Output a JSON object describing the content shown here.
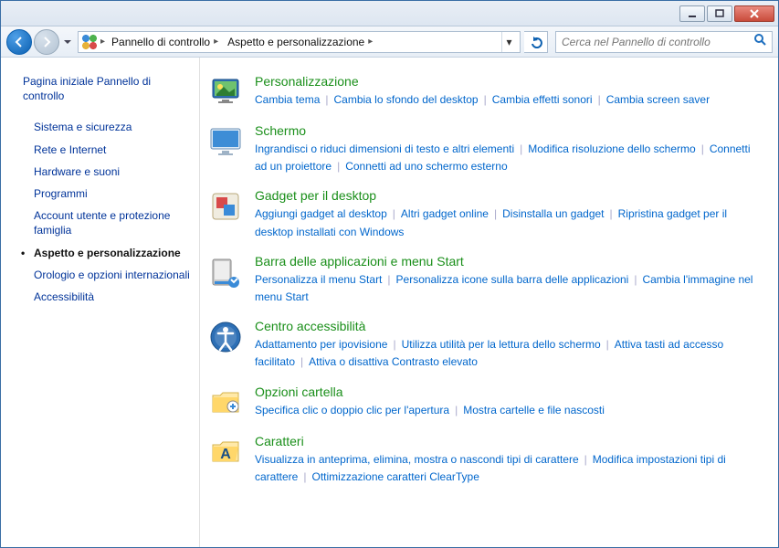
{
  "titlebar": {
    "min": "_",
    "max": "□",
    "close": "✕"
  },
  "breadcrumb": {
    "root_icon": "control-panel",
    "items": [
      "Pannello di controllo",
      "Aspetto e personalizzazione"
    ]
  },
  "search": {
    "placeholder": "Cerca nel Pannello di controllo"
  },
  "sidebar": {
    "home": "Pagina iniziale Pannello di controllo",
    "items": [
      {
        "label": "Sistema e sicurezza",
        "active": false
      },
      {
        "label": "Rete e Internet",
        "active": false
      },
      {
        "label": "Hardware e suoni",
        "active": false
      },
      {
        "label": "Programmi",
        "active": false
      },
      {
        "label": "Account utente e protezione famiglia",
        "active": false
      },
      {
        "label": "Aspetto e personalizzazione",
        "active": true
      },
      {
        "label": "Orologio e opzioni internazionali",
        "active": false
      },
      {
        "label": "Accessibilità",
        "active": false
      }
    ]
  },
  "categories": [
    {
      "icon": "personalization",
      "title": "Personalizzazione",
      "tasks": [
        "Cambia tema",
        "Cambia lo sfondo del desktop",
        "Cambia effetti sonori",
        "Cambia screen saver"
      ]
    },
    {
      "icon": "display",
      "title": "Schermo",
      "tasks": [
        "Ingrandisci o riduci dimensioni di testo e altri elementi",
        "Modifica risoluzione dello schermo",
        "Connetti ad un proiettore",
        "Connetti ad uno schermo esterno"
      ]
    },
    {
      "icon": "gadgets",
      "title": "Gadget per il desktop",
      "tasks": [
        "Aggiungi gadget al desktop",
        "Altri gadget online",
        "Disinstalla un gadget",
        "Ripristina gadget per il desktop installati con Windows"
      ]
    },
    {
      "icon": "taskbar",
      "title": "Barra delle applicazioni e menu Start",
      "tasks": [
        "Personalizza il menu Start",
        "Personalizza icone sulla barra delle applicazioni",
        "Cambia l'immagine nel menu Start"
      ]
    },
    {
      "icon": "ease",
      "title": "Centro accessibilità",
      "tasks": [
        "Adattamento per ipovisione",
        "Utilizza utilità per la lettura dello schermo",
        "Attiva tasti ad accesso facilitato",
        "Attiva o disattiva Contrasto elevato"
      ]
    },
    {
      "icon": "folder",
      "title": "Opzioni cartella",
      "tasks": [
        "Specifica clic o doppio clic per l'apertura",
        "Mostra cartelle e file nascosti"
      ]
    },
    {
      "icon": "fonts",
      "title": "Caratteri",
      "tasks": [
        "Visualizza in anteprima, elimina, mostra o nascondi tipi di carattere",
        "Modifica impostazioni tipi di carattere",
        "Ottimizzazione caratteri ClearType"
      ]
    }
  ]
}
